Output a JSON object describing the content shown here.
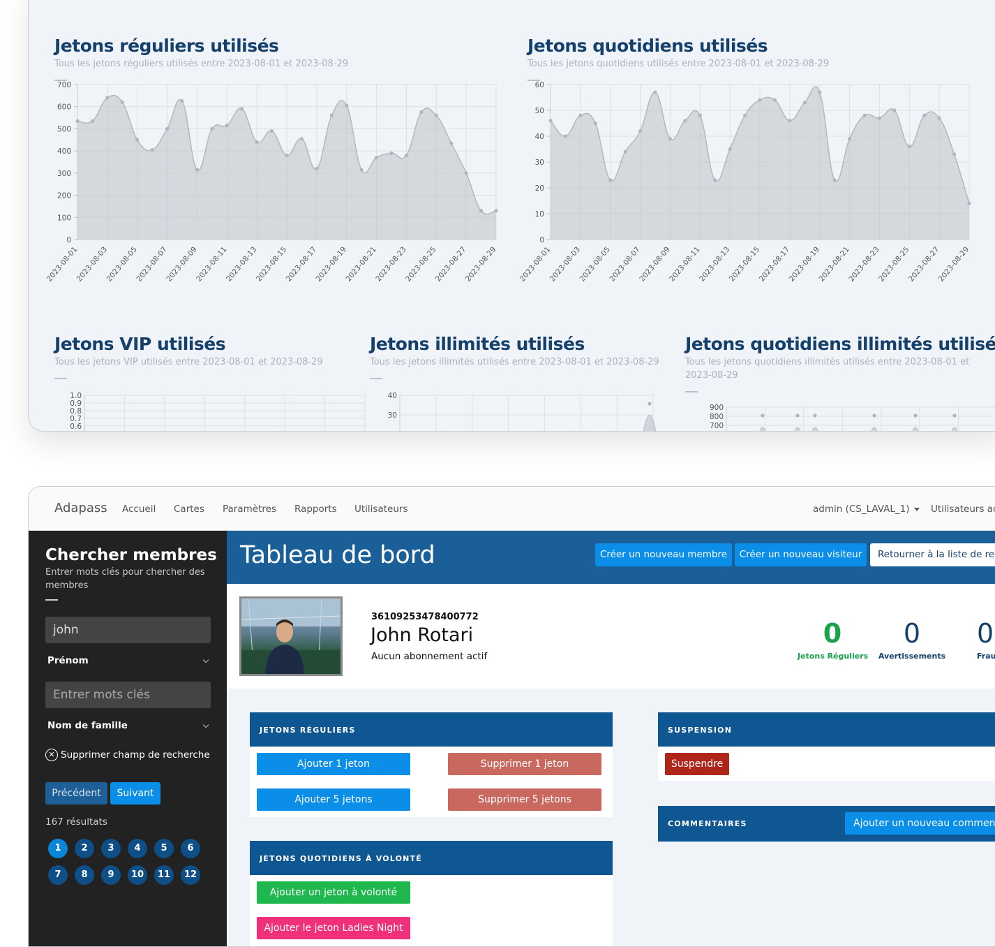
{
  "charts": [
    {
      "title": "Jetons réguliers utilisés",
      "subtitle": "Tous les jetons réguliers utilisés entre 2023-08-01 et 2023-08-29",
      "chart_data": {
        "type": "area",
        "ylim": [
          0,
          700
        ],
        "yticks": [
          0,
          100,
          200,
          300,
          400,
          500,
          600,
          700
        ],
        "x": [
          "2023-08-01",
          "2023-08-02",
          "2023-08-03",
          "2023-08-04",
          "2023-08-05",
          "2023-08-06",
          "2023-08-07",
          "2023-08-08",
          "2023-08-09",
          "2023-08-10",
          "2023-08-11",
          "2023-08-12",
          "2023-08-13",
          "2023-08-14",
          "2023-08-15",
          "2023-08-16",
          "2023-08-17",
          "2023-08-18",
          "2023-08-19",
          "2023-08-20",
          "2023-08-21",
          "2023-08-22",
          "2023-08-23",
          "2023-08-24",
          "2023-08-25",
          "2023-08-26",
          "2023-08-27",
          "2023-08-28",
          "2023-08-29"
        ],
        "xticks": [
          "2023-08-01",
          "2023-08-03",
          "2023-08-05",
          "2023-08-07",
          "2023-08-09",
          "2023-08-11",
          "2023-08-13",
          "2023-08-15",
          "2023-08-17",
          "2023-08-19",
          "2023-08-21",
          "2023-08-23",
          "2023-08-25",
          "2023-08-27",
          "2023-08-29"
        ],
        "values": [
          535,
          535,
          640,
          620,
          450,
          405,
          500,
          625,
          315,
          500,
          515,
          590,
          440,
          490,
          380,
          455,
          320,
          560,
          605,
          315,
          370,
          390,
          380,
          575,
          560,
          435,
          300,
          130,
          130
        ]
      }
    },
    {
      "title": "Jetons quotidiens utilisés",
      "subtitle": "Tous les jetons quotidiens utilisés entre 2023-08-01 et 2023-08-29",
      "chart_data": {
        "type": "area",
        "ylim": [
          0,
          60
        ],
        "yticks": [
          0,
          10,
          20,
          30,
          40,
          50,
          60
        ],
        "x": [
          "2023-08-01",
          "2023-08-02",
          "2023-08-03",
          "2023-08-04",
          "2023-08-05",
          "2023-08-06",
          "2023-08-07",
          "2023-08-08",
          "2023-08-09",
          "2023-08-10",
          "2023-08-11",
          "2023-08-12",
          "2023-08-13",
          "2023-08-14",
          "2023-08-15",
          "2023-08-16",
          "2023-08-17",
          "2023-08-18",
          "2023-08-19",
          "2023-08-20",
          "2023-08-21",
          "2023-08-22",
          "2023-08-23",
          "2023-08-24",
          "2023-08-25",
          "2023-08-26",
          "2023-08-27",
          "2023-08-28",
          "2023-08-29"
        ],
        "xticks": [
          "2023-08-01",
          "2023-08-03",
          "2023-08-05",
          "2023-08-07",
          "2023-08-09",
          "2023-08-11",
          "2023-08-13",
          "2023-08-15",
          "2023-08-17",
          "2023-08-19",
          "2023-08-21",
          "2023-08-23",
          "2023-08-25",
          "2023-08-27",
          "2023-08-29"
        ],
        "values": [
          46,
          40,
          48,
          45,
          23,
          34,
          42,
          57,
          39,
          46,
          48,
          23,
          35,
          48,
          54,
          54,
          46,
          53,
          57,
          23,
          39,
          48,
          47,
          50,
          36,
          48,
          47,
          33,
          14
        ]
      }
    },
    {
      "title": "Jetons VIP utilisés",
      "subtitle": "Tous les jetons VIP utilisés entre 2023-08-01 et 2023-08-29",
      "chart_data": {
        "type": "area",
        "yticks": [
          "1.0",
          "0.9",
          "0.8",
          "0.7",
          "0.6"
        ],
        "values": []
      }
    },
    {
      "title": "Jetons illimités utilisés",
      "subtitle": "Tous les jetons illimités utilisés entre 2023-08-01 et 2023-08-29",
      "chart_data": {
        "type": "area",
        "yticks": [
          "40",
          "30"
        ],
        "values": []
      }
    },
    {
      "title": "Jetons quotidiens illimités utilisés",
      "subtitle": "Tous les jetons quotidiens illimités utilisés entre 2023-08-01 et 2023-08-29",
      "chart_data": {
        "type": "area",
        "yticks": [
          "900",
          "800",
          "700"
        ],
        "values": []
      }
    }
  ],
  "navbar": {
    "brand": "Adapass",
    "links": [
      "Accueil",
      "Cartes",
      "Paramètres",
      "Rapports",
      "Utilisateurs"
    ],
    "user_menu": "admin (CS_LAVAL_1)",
    "right_link": "Utilisateurs ac"
  },
  "sidebar": {
    "title": "Chercher membres",
    "subtitle": "Entrer mots clés pour chercher des membres",
    "search1_value": "john",
    "select1": "Prénom",
    "search2_placeholder": "Entrer mots clés",
    "select2": "Nom de famille",
    "clear_label": "Supprimer champ de recherche",
    "prev_label": "Précédent",
    "next_label": "Suivant",
    "results": "167 résultats",
    "pages": [
      "1",
      "2",
      "3",
      "4",
      "5",
      "6",
      "7",
      "8",
      "9",
      "10",
      "11",
      "12"
    ],
    "active_page": "1"
  },
  "header": {
    "title": "Tableau de bord",
    "btn_new_member": "Créer un nouveau membre",
    "btn_new_visitor": "Créer un nouveau visiteur",
    "btn_return": "Retourner à la liste de rech"
  },
  "profile": {
    "card_id": "36109253478400772",
    "name": "John Rotari",
    "subscription": "Aucun abonnement actif",
    "stats": [
      {
        "value": "0",
        "label": "Jetons Réguliers",
        "color": "#19a34a"
      },
      {
        "value": "0",
        "label": "Avertissements",
        "color": "#14406b"
      },
      {
        "value": "0",
        "label": "Frauc",
        "color": "#14406b"
      }
    ]
  },
  "panels": {
    "regular": {
      "title": "JETONS RÉGULIERS",
      "add1": "Ajouter 1 jeton",
      "remove1": "Supprimer 1 jeton",
      "add5": "Ajouter 5 jetons",
      "remove5": "Supprimer 5 jetons"
    },
    "daily": {
      "title": "JETONS QUOTIDIENS À VOLONTÉ",
      "add_unlimited": "Ajouter un jeton à volonté",
      "add_ladies": "Ajouter le jeton Ladies Night"
    },
    "suspension": {
      "title": "SUSPENSION",
      "suspend": "Suspendre"
    },
    "comments": {
      "title": "COMMENTAIRES",
      "add_comment": "Ajouter un nouveau commentai"
    }
  },
  "colors": {
    "blue_primary": "#0a8ee8",
    "red_muted": "#c9685f",
    "red_dark": "#b0251a",
    "green": "#1fb84f",
    "pink": "#f0307a",
    "panel_head": "#0e5792",
    "header_bg": "#1b5f98"
  }
}
